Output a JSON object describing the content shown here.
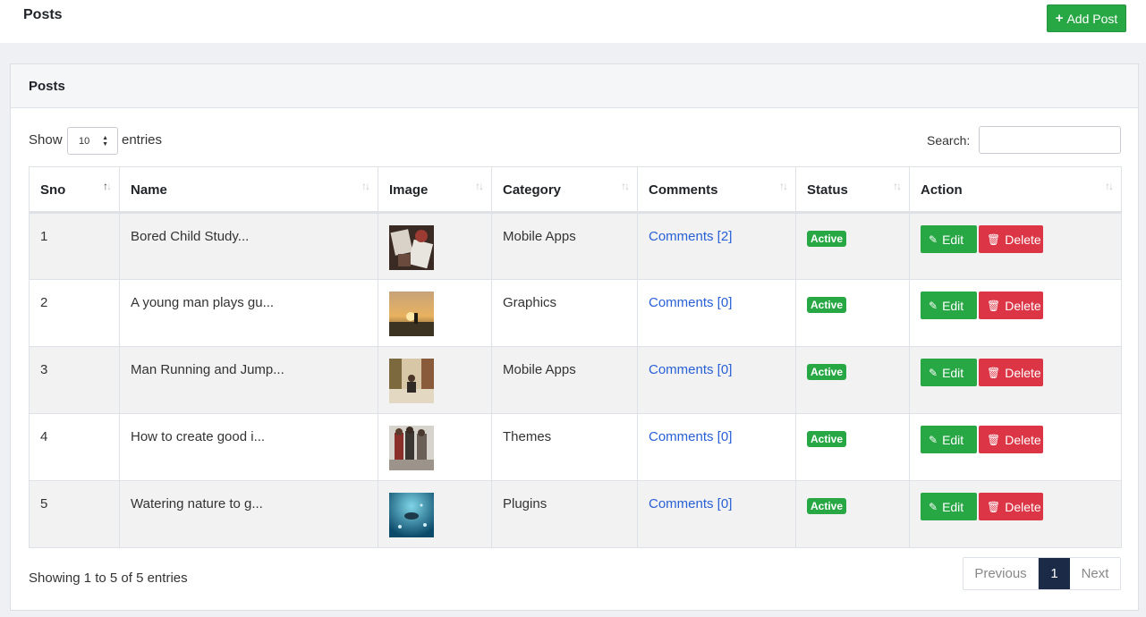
{
  "header": {
    "title": "Posts",
    "add_button": "Add Post"
  },
  "card": {
    "title": "Posts"
  },
  "controls": {
    "show_label": "Show",
    "page_length": "10",
    "entries_label": "entries",
    "search_label": "Search:",
    "search_value": ""
  },
  "table": {
    "columns": [
      "Sno",
      "Name",
      "Image",
      "Category",
      "Comments",
      "Status",
      "Action"
    ],
    "rows": [
      {
        "sno": "1",
        "name": "Bored Child Study...",
        "category": "Mobile Apps",
        "comments": "Comments [2]",
        "status": "Active"
      },
      {
        "sno": "2",
        "name": "A young man plays gu...",
        "category": "Graphics",
        "comments": "Comments [0]",
        "status": "Active"
      },
      {
        "sno": "3",
        "name": "Man Running and Jump...",
        "category": "Mobile Apps",
        "comments": "Comments [0]",
        "status": "Active"
      },
      {
        "sno": "4",
        "name": "How to create good i...",
        "category": "Themes",
        "comments": "Comments [0]",
        "status": "Active"
      },
      {
        "sno": "5",
        "name": "Watering nature to g...",
        "category": "Plugins",
        "comments": "Comments [0]",
        "status": "Active"
      }
    ],
    "edit_label": "Edit",
    "delete_label": "Delete"
  },
  "footer": {
    "info": "Showing 1 to 5 of 5 entries",
    "prev": "Previous",
    "current_page": "1",
    "next": "Next"
  },
  "colors": {
    "success": "#28a745",
    "danger": "#dc3545",
    "link": "#2860d6",
    "pager_active": "#1b2a47"
  },
  "icons": {
    "add": "plus-icon",
    "edit": "edit-icon",
    "delete": "trash-icon",
    "sort": "sort-icon"
  }
}
